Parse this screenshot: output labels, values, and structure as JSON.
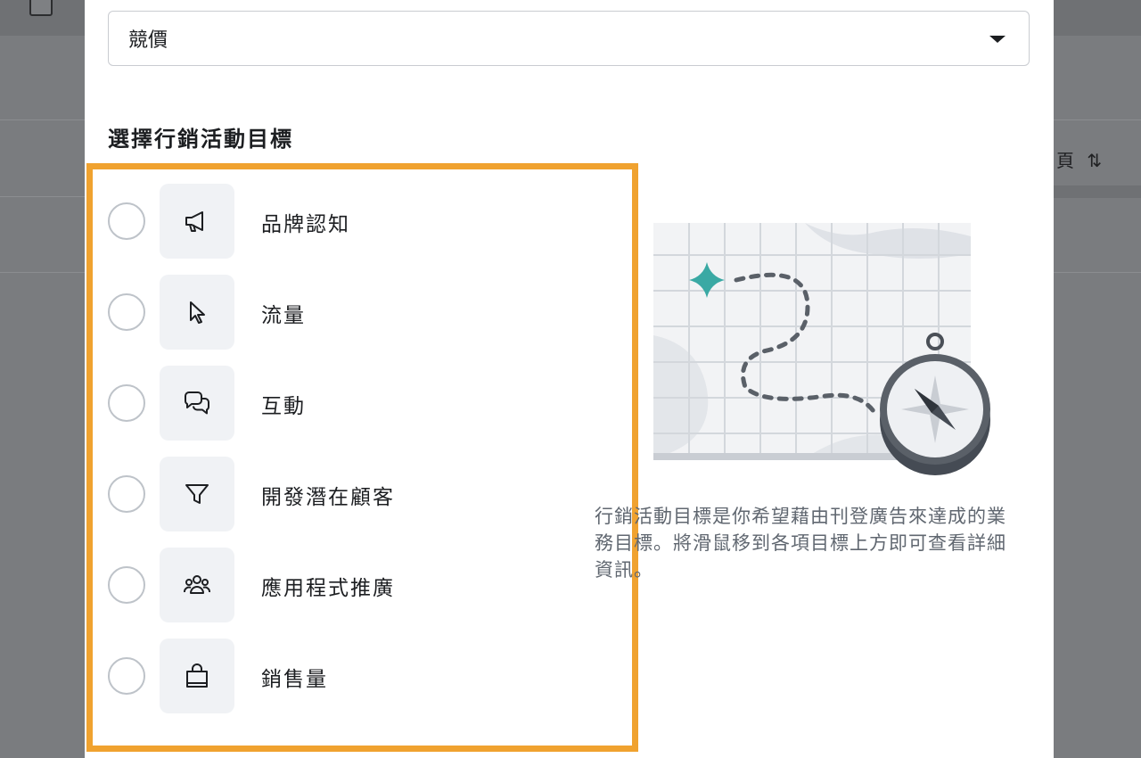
{
  "dropdown": {
    "value": "競價"
  },
  "section_title": "選擇行銷活動目標",
  "objectives": [
    {
      "label": "品牌認知",
      "icon": "megaphone-icon"
    },
    {
      "label": "流量",
      "icon": "cursor-icon"
    },
    {
      "label": "互動",
      "icon": "chat-bubbles-icon"
    },
    {
      "label": "開發潛在顧客",
      "icon": "funnel-icon"
    },
    {
      "label": "應用程式推廣",
      "icon": "people-icon"
    },
    {
      "label": "銷售量",
      "icon": "shopping-bag-icon"
    }
  ],
  "description": "行銷活動目標是你希望藉由刊登廣告來達成的業務目標。將滑鼠移到各項目標上方即可查看詳細資訊。",
  "colors": {
    "highlight": "#f0a22f",
    "accent_teal": "#3aa9a4",
    "overlay": "#7a7c7f"
  }
}
